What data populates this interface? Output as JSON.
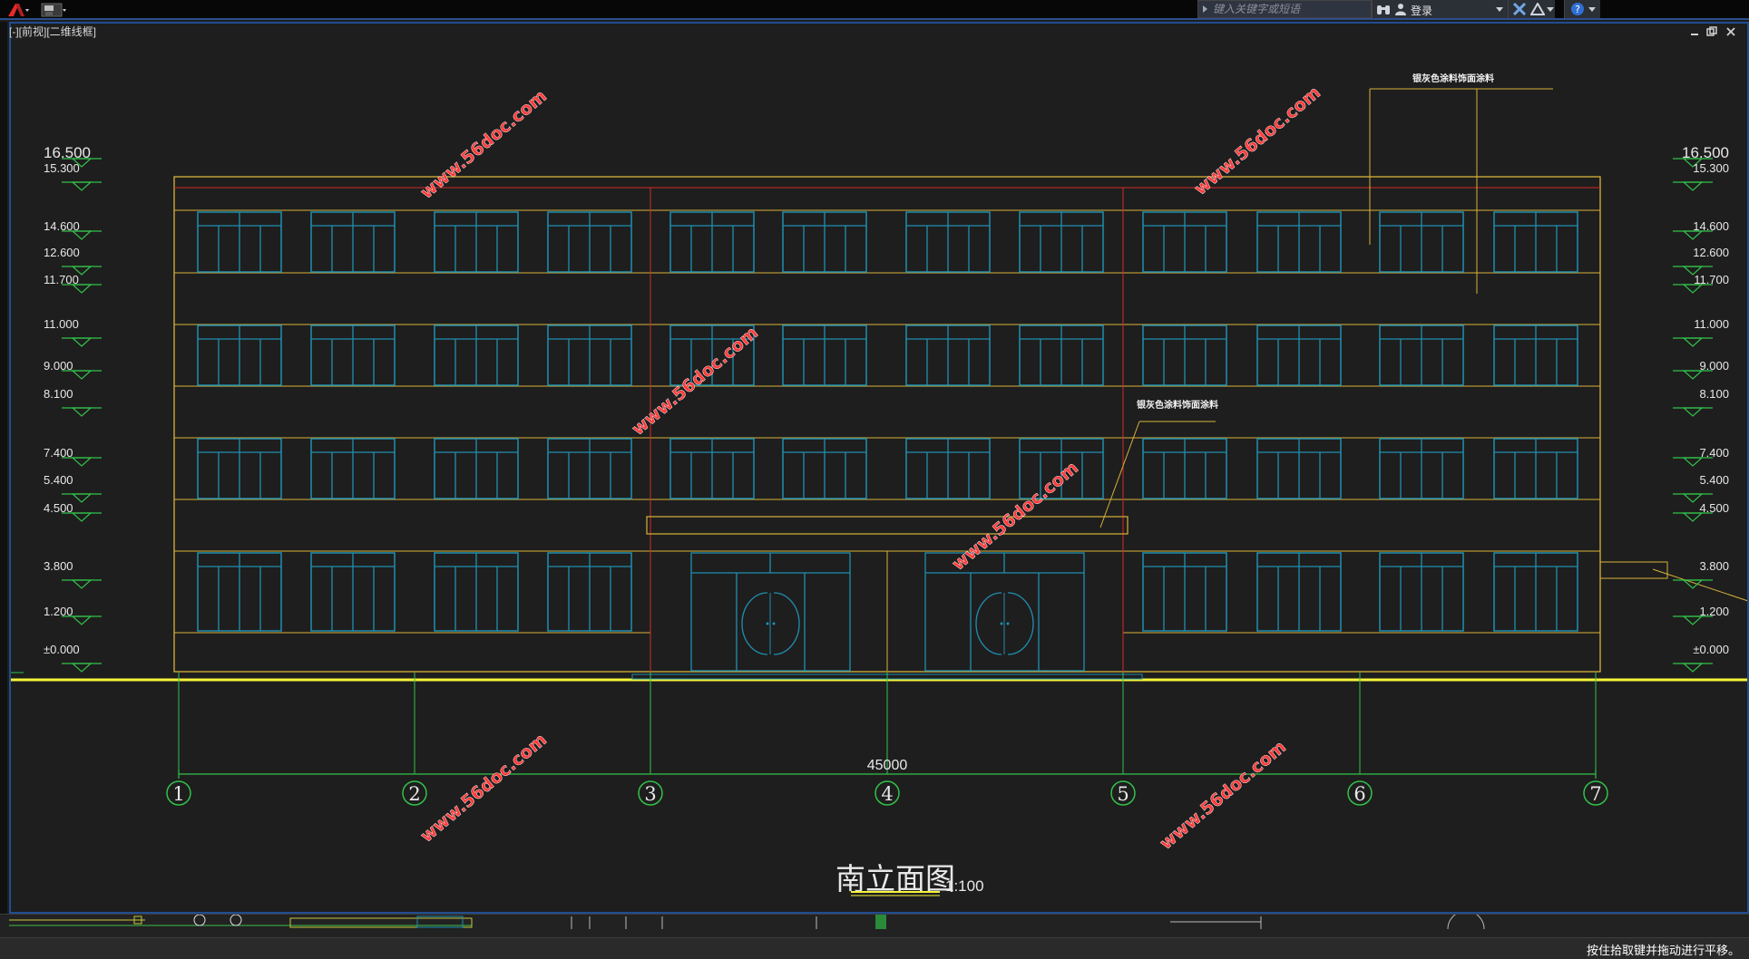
{
  "toolbar": {
    "search_placeholder": "键入关键字或短语",
    "login_label": "登录"
  },
  "viewport": {
    "label": "[-][前视][二维线框]"
  },
  "drawing": {
    "title": "南立面图",
    "scale": "1:100",
    "total_dimension": "45000",
    "grid_axes": [
      "1",
      "2",
      "3",
      "4",
      "5",
      "6",
      "7"
    ],
    "elevations_left": [
      "16.500",
      "15.300",
      "14.600",
      "12.600",
      "11.700",
      "11.000",
      "9.000",
      "8.100",
      "7.400",
      "5.400",
      "4.500",
      "3.800",
      "1.200",
      "±0.000"
    ],
    "elevations_right": [
      "16.500",
      "15.300",
      "14.600",
      "12.600",
      "11.700",
      "11.000",
      "9.000",
      "8.100",
      "7.400",
      "5.400",
      "4.500",
      "3.800",
      "1.200",
      "±0.000"
    ],
    "annotation_top": "银灰色涂料饰面涂料",
    "annotation_mid": "银灰色涂料饰面涂料",
    "watermark": "www.56doc.com",
    "colors": {
      "background": "#1e1e1e",
      "outline": "#d8b23a",
      "window": "#1f8fb0",
      "grid": "#33c24a",
      "axis_red": "#d12b2b",
      "ground": "#f5f53a",
      "watermark": "#ff3b3b"
    }
  },
  "status": {
    "command_message": "按住拾取键并拖动进行平移。"
  }
}
